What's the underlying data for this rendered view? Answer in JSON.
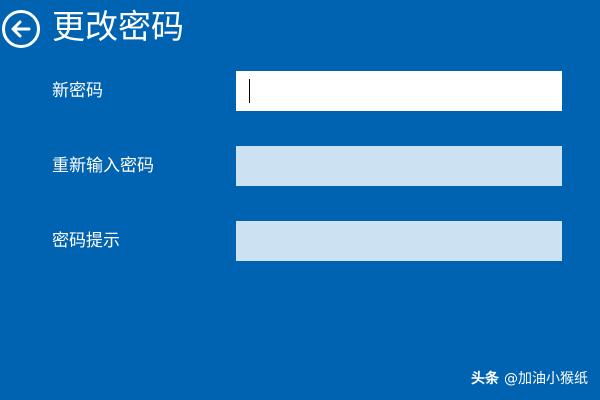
{
  "header": {
    "back_icon": "back-arrow-icon",
    "title": "更改密码"
  },
  "form": {
    "new_password": {
      "label": "新密码",
      "value": "",
      "placeholder": ""
    },
    "confirm_password": {
      "label": "重新输入密码",
      "value": "",
      "placeholder": ""
    },
    "password_hint": {
      "label": "密码提示",
      "value": "",
      "placeholder": ""
    }
  },
  "watermark": {
    "brand": "头条",
    "handle": "@加油小猴纸"
  },
  "colors": {
    "background": "#0063b1",
    "text": "#ffffff",
    "input_focused": "#ffffff",
    "input_idle": "#cce1f1"
  }
}
